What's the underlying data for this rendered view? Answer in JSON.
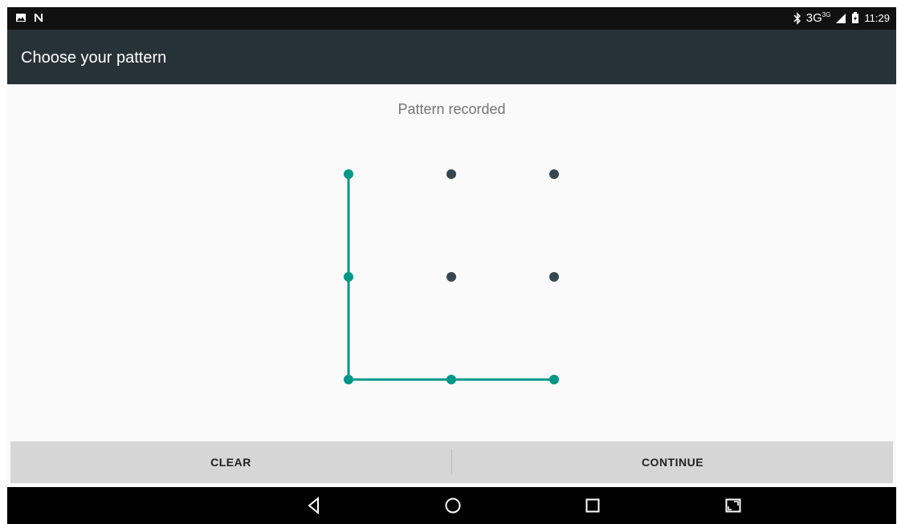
{
  "status_bar": {
    "left_icons": [
      "image-icon",
      "n-icon"
    ],
    "network": "3G",
    "network_sub": "3G",
    "time": "11:29"
  },
  "app_bar": {
    "title": "Choose your pattern"
  },
  "pattern": {
    "headline": "Pattern recorded",
    "grid": [
      "1-1",
      "1-2",
      "1-3",
      "2-1",
      "2-2",
      "2-3",
      "3-1",
      "3-2",
      "3-3"
    ],
    "selected_path": [
      "1-1",
      "2-1",
      "3-1",
      "3-2",
      "3-3"
    ],
    "colors": {
      "selected": "#009688",
      "idle": "#37474f"
    }
  },
  "buttons": {
    "clear": "CLEAR",
    "continue": "CONTINUE"
  },
  "nav_bar": {
    "items": [
      "back-icon",
      "home-icon",
      "recents-icon",
      "screenshot-icon"
    ]
  }
}
